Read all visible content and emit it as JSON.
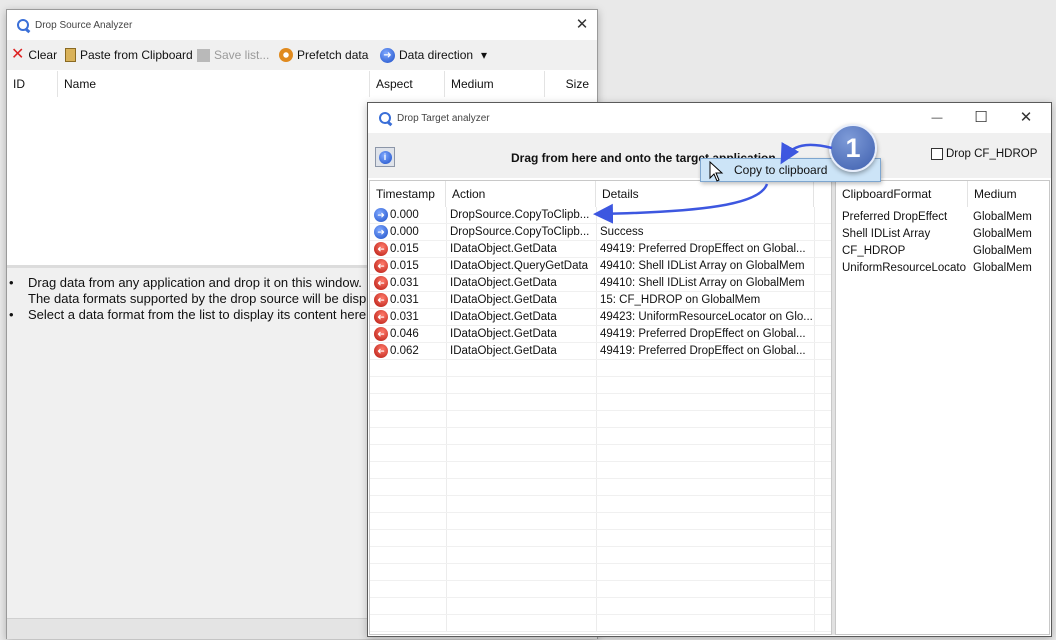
{
  "source_window": {
    "title": "Drop Source Analyzer",
    "close_glyph": "✕",
    "toolbar": {
      "clear": "Clear",
      "paste": "Paste from Clipboard",
      "save": "Save list...",
      "prefetch": "Prefetch data",
      "direction": "Data direction",
      "dropdown_glyph": "▾"
    },
    "columns": [
      "ID",
      "Name",
      "Aspect",
      "Medium",
      "Size"
    ],
    "info": {
      "line1": "Drag data from any application and drop it on this window.",
      "line2": "The data formats supported by the drop source will be displayed in the list above.",
      "line3": "Select a data format from the list to display its content here."
    }
  },
  "target_window": {
    "title": "Drop Target analyzer",
    "minimize_glyph": "—",
    "maximize_glyph": "☐",
    "close_glyph": "✕",
    "drag_label": "Drag from here and onto the target application",
    "drop_hdrop_label": "Drop CF_HDROP",
    "log_columns": [
      "Timestamp",
      "Action",
      "Details"
    ],
    "log_rows": [
      {
        "dir": "out",
        "timestamp": "0.000",
        "action": "DropSource.CopyToClipb...",
        "details": ""
      },
      {
        "dir": "out",
        "timestamp": "0.000",
        "action": "DropSource.CopyToClipb...",
        "details": "Success"
      },
      {
        "dir": "in",
        "timestamp": "0.015",
        "action": "IDataObject.GetData",
        "details": "49419: Preferred DropEffect on Global..."
      },
      {
        "dir": "in",
        "timestamp": "0.015",
        "action": "IDataObject.QueryGetData",
        "details": "49410: Shell IDList Array on GlobalMem"
      },
      {
        "dir": "in",
        "timestamp": "0.031",
        "action": "IDataObject.GetData",
        "details": "49410: Shell IDList Array on GlobalMem"
      },
      {
        "dir": "in",
        "timestamp": "0.031",
        "action": "IDataObject.GetData",
        "details": "15: CF_HDROP on GlobalMem"
      },
      {
        "dir": "in",
        "timestamp": "0.031",
        "action": "IDataObject.GetData",
        "details": "49423: UniformResourceLocator on Glo..."
      },
      {
        "dir": "in",
        "timestamp": "0.046",
        "action": "IDataObject.GetData",
        "details": "49419: Preferred DropEffect on Global..."
      },
      {
        "dir": "in",
        "timestamp": "0.062",
        "action": "IDataObject.GetData",
        "details": "49419: Preferred DropEffect on Global..."
      }
    ],
    "format_columns": [
      "ClipboardFormat",
      "Medium"
    ],
    "format_rows": [
      {
        "format": "Preferred DropEffect",
        "medium": "GlobalMem"
      },
      {
        "format": "Shell IDList Array",
        "medium": "GlobalMem"
      },
      {
        "format": "CF_HDROP",
        "medium": "GlobalMem"
      },
      {
        "format": "UniformResourceLocator",
        "medium": "GlobalMem"
      }
    ]
  },
  "tooltip": {
    "text": "Copy to clipboard"
  },
  "callout": {
    "number": "1"
  },
  "colors": {
    "accent": "#3a6fd8",
    "callout": "#5b7fc4",
    "tooltip_bg": "#cce4f7",
    "arrow": "#3d57e0"
  }
}
